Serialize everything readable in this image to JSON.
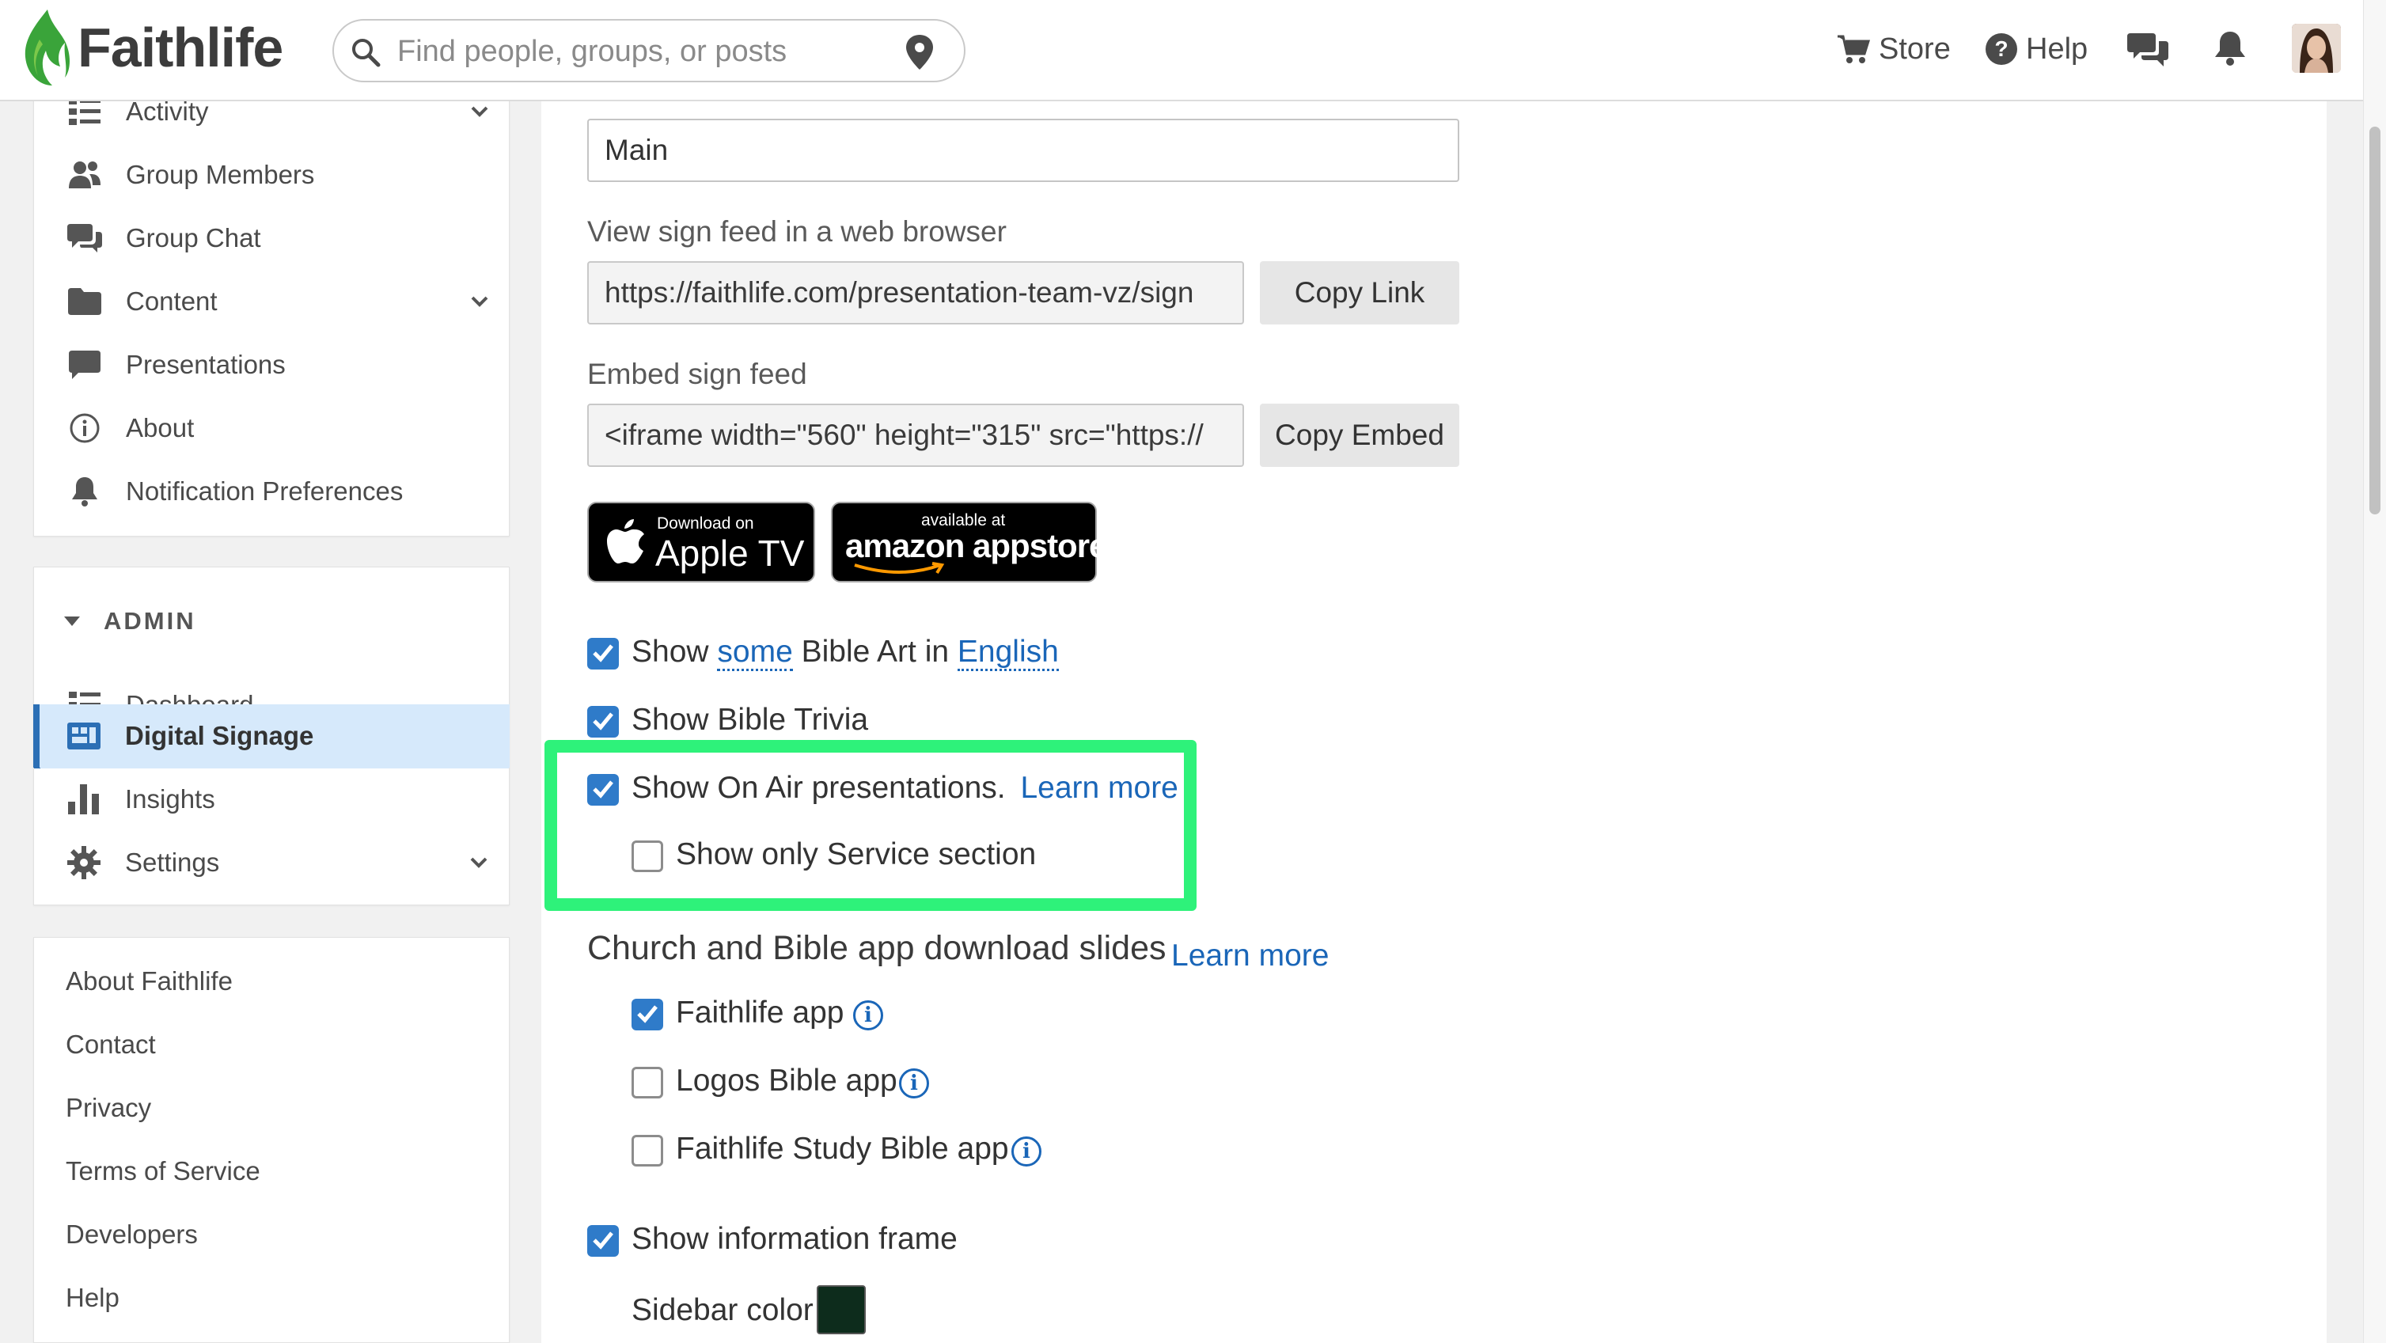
{
  "header": {
    "logo_text": "Faithlife",
    "search_placeholder": "Find people, groups, or posts",
    "store_label": "Store",
    "help_label": "Help",
    "icons": [
      "search-icon",
      "map-pin-icon",
      "cart-icon",
      "help-icon",
      "chat-icon",
      "bell-icon"
    ]
  },
  "sidebar": {
    "nav_items": [
      {
        "label": "Activity",
        "icon": "activity-list-icon",
        "has_chevron": true
      },
      {
        "label": "Group Members",
        "icon": "people-icon"
      },
      {
        "label": "Group Chat",
        "icon": "chat-bubbles-icon"
      },
      {
        "label": "Content",
        "icon": "folder-icon",
        "has_chevron": true
      },
      {
        "label": "Presentations",
        "icon": "speech-bubble-icon"
      },
      {
        "label": "About",
        "icon": "info-icon"
      },
      {
        "label": "Notification Preferences",
        "icon": "bell-icon"
      }
    ],
    "admin": {
      "title": "ADMIN",
      "items": [
        {
          "label": "Dashboard",
          "icon": "dashboard-icon"
        },
        {
          "label": "Digital Signage",
          "icon": "signage-icon",
          "active": true
        },
        {
          "label": "Insights",
          "icon": "bar-chart-icon"
        },
        {
          "label": "Settings",
          "icon": "gear-icon",
          "has_chevron": true
        }
      ]
    },
    "footer_links": [
      "About Faithlife",
      "Contact",
      "Privacy",
      "Terms of Service",
      "Developers",
      "Help"
    ]
  },
  "main": {
    "title_input_value": "Main",
    "sign_feed_label": "View sign feed in a web browser",
    "sign_feed_url": "https://faithlife.com/presentation-team-vz/sign",
    "copy_link_label": "Copy Link",
    "embed_label": "Embed sign feed",
    "embed_code": "<iframe width=\"560\" height=\"315\" src=\"https://",
    "copy_embed_label": "Copy Embed",
    "apple_badge": {
      "small": "Download on",
      "big": "Apple TV"
    },
    "amazon_badge": {
      "small": "available at",
      "big": "amazon appstore"
    },
    "bible_art": {
      "prefix": "Show",
      "some": "some",
      "middle": "Bible Art in",
      "language": "English",
      "checked": true
    },
    "bible_trivia": {
      "label": "Show Bible Trivia",
      "checked": true
    },
    "on_air": {
      "label": "Show On Air presentations.",
      "learn_more": "Learn more",
      "checked": true
    },
    "service_only": {
      "label": "Show only Service section",
      "checked": false
    },
    "download_slides": {
      "title": "Church and Bible app download slides",
      "learn_more": "Learn more"
    },
    "apps": [
      {
        "label": "Faithlife app",
        "checked": true
      },
      {
        "label": "Logos Bible app",
        "checked": false
      },
      {
        "label": "Faithlife Study Bible app",
        "checked": false
      }
    ],
    "info_frame": {
      "label": "Show information frame",
      "checked": true
    },
    "sidebar_color": {
      "label": "Sidebar color",
      "value": "#0d2c1c"
    }
  },
  "colors": {
    "accent": "#2f7bc9",
    "highlight": "#2ef27a",
    "active_nav_bg": "#d6e9fb",
    "brand_green": "#3aa43a"
  }
}
